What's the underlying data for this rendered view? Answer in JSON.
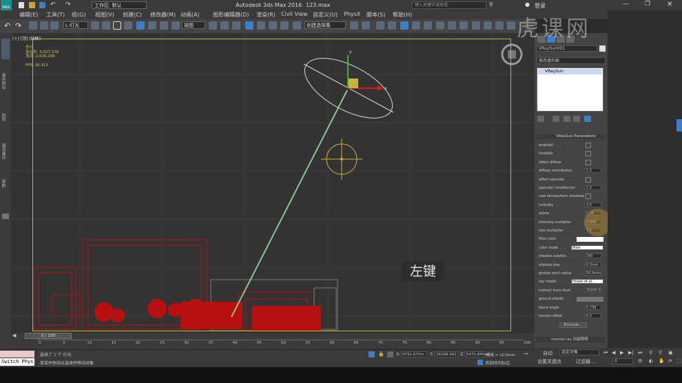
{
  "title_bar": {
    "workspace": "工作区: 默认",
    "title": "Autodesk 3ds Max 2016",
    "filename": "123.max",
    "search_placeholder": "键入关键字或短语",
    "login": "登录"
  },
  "menu": [
    "编辑(E)",
    "工具(T)",
    "组(G)",
    "视图(V)",
    "创建(C)",
    "修改器(M)",
    "动画(A)",
    "图形编辑器(D)",
    "渲染(R)",
    "Civil View",
    "自定义(U)",
    "PhysX",
    "脚本(S)",
    "帮助(H)"
  ],
  "toolbar": {
    "filter": "L-灯光",
    "coord": "视图",
    "selection_set": "创建选择集"
  },
  "left_tabs": [
    "自由对象",
    "选择",
    "对象绘制",
    "填充"
  ],
  "viewport": {
    "label": "[+] [顶] [线框]",
    "stats_label": "总计",
    "polys_label": "多边形:",
    "polys_value": "3,027,378",
    "verts_label": "顶点:",
    "verts_value": "2,016,299",
    "fps_label": "FPS:",
    "fps_value": "36.313",
    "watermark": "左键"
  },
  "timeline": {
    "frame_label": "0 / 100",
    "ticks": [
      "0",
      "5",
      "10",
      "15",
      "20",
      "25",
      "30",
      "35",
      "40",
      "45",
      "50",
      "55",
      "60",
      "65",
      "70",
      "75",
      "80",
      "85",
      "90",
      "95",
      "100"
    ]
  },
  "status": {
    "script_label": "Switch Phys",
    "message_top": "选择了 1 个 灯光",
    "message_bottom": "单击并拖动以选择并移动对象",
    "x": "9791.675m",
    "y": "16206.992",
    "z": "5471.845m",
    "grid": "栅格 = 10.0mm",
    "add_time_tag": "添加时间标记"
  },
  "right_panel": {
    "object_name": "VRaySun001",
    "modifier_list": "修改器列表",
    "stack_item": "VRaySun",
    "rollout_title": "VRaySun Parameters",
    "params": [
      {
        "label": "enabled",
        "value": ""
      },
      {
        "label": "invisible",
        "value": ""
      },
      {
        "label": "affect diffuse",
        "value": ""
      },
      {
        "label": "diffuse contribution",
        "value": "1.0"
      },
      {
        "label": "affect specular",
        "value": ""
      },
      {
        "label": "specular contribution",
        "value": "1.0"
      },
      {
        "label": "cast atmospheric shadows",
        "value": ""
      },
      {
        "label": "turbidity",
        "value": "3.0"
      },
      {
        "label": "ozone",
        "value": "0.35"
      },
      {
        "label": "intensity multiplier",
        "value": "0.004"
      },
      {
        "label": "size multiplier",
        "value": "3.0"
      },
      {
        "label": "filter color",
        "value": ""
      },
      {
        "label": "color mode",
        "value": "filter"
      },
      {
        "label": "shadow subdivs",
        "value": "160"
      },
      {
        "label": "shadow bias",
        "value": "0.2mm"
      },
      {
        "label": "photon emit radius",
        "value": "50.0mm"
      },
      {
        "label": "sky model",
        "value": "Hosek et al."
      },
      {
        "label": "indirect horiz illum",
        "value": "25000.0"
      },
      {
        "label": "ground albedo",
        "value": ""
      },
      {
        "label": "blend angle",
        "value": "5.739"
      },
      {
        "label": "horizon offset",
        "value": "0.0"
      }
    ],
    "exclude_btn": "Exclude...",
    "mental_ray": "mental ray 间接照明"
  },
  "bottom_right": {
    "auto_key": "自动",
    "selected": "选定对象",
    "set_key": "设置关键点",
    "filter": "过滤器...",
    "frame": "0"
  },
  "colors": {
    "viewport_border": "#c9b43a",
    "line_light": "#8fc48f",
    "red_geo": "#b81010",
    "yellow_target": "#c9b43a"
  }
}
